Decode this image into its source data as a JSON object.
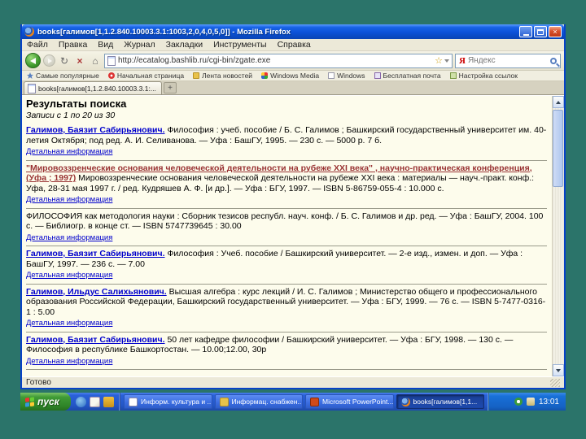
{
  "colors": {
    "desktop_teal": "#2b746a",
    "titlebar_blue": "#0b51d8",
    "taskbar_blue": "#2a61d8",
    "link_blue": "#0000cc",
    "link_visited_maroon": "#993333",
    "content_bg": "#fdfcec",
    "chrome_bg": "#ece9d8",
    "start_green": "#3f9a35"
  },
  "window": {
    "title": "books[галимов[1,1.2.840.10003.3.1:1003,2,0,4,0,5,0]] - Mozilla Firefox",
    "close_glyph": "×"
  },
  "menu": {
    "items": [
      "Файл",
      "Правка",
      "Вид",
      "Журнал",
      "Закладки",
      "Инструменты",
      "Справка"
    ]
  },
  "toolbar": {
    "url": "http://ecatalog.bashlib.ru/cgi-bin/zgate.exe",
    "refresh_glyph": "↻",
    "stop_glyph": "×",
    "home_glyph": "⌂",
    "star_glyph": "☆",
    "search_placeholder": "Яндекс",
    "search_engine_glyph": "Я"
  },
  "bookmarks": {
    "items": [
      "Самые популярные",
      "Начальная страница",
      "Лента новостей",
      "Windows Media",
      "Windows",
      "Бесплатная почта",
      "Настройка ссылок"
    ]
  },
  "tabs": {
    "active_label": "books[галимов[1,1.2.840.10003.3.1:...",
    "new_tab_glyph": "+"
  },
  "content": {
    "title": "Результаты поиска",
    "range_note": "Записи с 1 по 20 из 30",
    "details_link_label": "Детальная информация",
    "results": [
      {
        "author": "Галимов, Баязит Сабирьянович.",
        "text": " Философия : учеб. пособие / Б. С. Галимов ; Башкирский государственный университет им. 40-летия Октября; под ред. А. И. Селиванова. — Уфа : БашГУ, 1995. — 230 с. — 5000 р. 7 б."
      },
      {
        "author": "\"Мировоззренческие основания человеческой деятельности на рубеже XXI века\" , научно-практическая конференция, (Уфа ; 1997)",
        "text": " Мировоззренческие основания человеческой деятельности на рубеже XXI века : материалы — науч.-практ. конф.: Уфа, 28-31 мая 1997 г. / ред. Кудряшев А. Ф. [и др.]. — Уфа : БГУ, 1997. — ISBN 5-86759-055-4 : 10.000 с."
      },
      {
        "author": "",
        "text": "ФИЛОСОФИЯ как методология науки : Сборник тезисов республ. науч. конф. / Б. С. Галимов и др. ред. — Уфа : БашГУ, 2004. 100 с. — Библиогр. в конце ст. — ISBN 5747739645 : 30.00"
      },
      {
        "author": "Галимов, Баязит Сабирьянович.",
        "text": " Философия : Учеб. пособие / Башкирский университет. — 2-е изд., измен. и доп. — Уфа : БашГУ, 1997. — 236 с. — 7.00"
      },
      {
        "author": "Галимов, Ильдус Салихьянович.",
        "text": " Высшая алгебра : курс лекций / И. С. Галимов ; Министерство общего и профессионального образования Российской Федерации, Башкирский государственный университет. — Уфа : БГУ, 1999. — 76 с. — ISBN 5-7477-0316-1 : 5.00"
      },
      {
        "author": "Галимов, Баязит Сабирьянович.",
        "text": " 50 лет кафедре философии / Башкирский университет. — Уфа : БГУ, 1998. — 130 с. — Философия в республике Башкортостан. — 10.00;12.00, 30р"
      }
    ]
  },
  "statusbar": {
    "text": "Готово"
  },
  "taskbar": {
    "start_label": "пуск",
    "tasks": [
      {
        "label": "Информ. культура и ..."
      },
      {
        "label": "Информац. снабжен..."
      },
      {
        "label": "Microsoft PowerPoint..."
      },
      {
        "label": "books[галимов[1,1..."
      }
    ],
    "clock": "13:01"
  }
}
